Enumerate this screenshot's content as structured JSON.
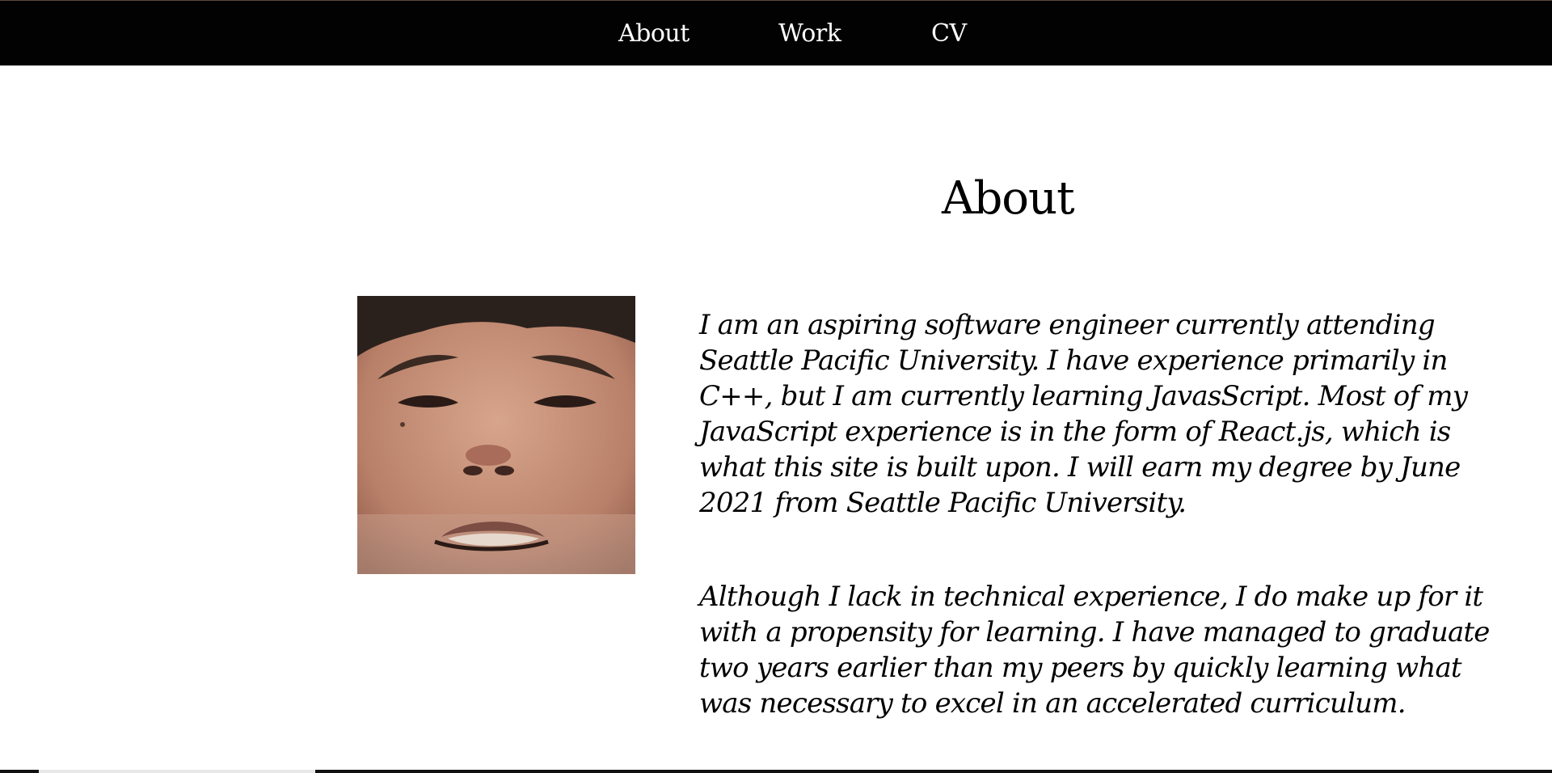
{
  "nav": {
    "items": [
      {
        "label": "About"
      },
      {
        "label": "Work"
      },
      {
        "label": "CV"
      }
    ]
  },
  "main": {
    "title": "About",
    "portrait_icon": "portrait-photo",
    "paragraphs": [
      "I am an aspiring software engineer currently attending Seattle Pacific University. I have experience primarily in C++, but I am currently learning JavasScript. Most of my JavaScript experience is in the form of React.js, which is what this site is built upon. I will earn my degree by June 2021 from Seattle Pacific University.",
      "Although I lack in technical experience, I do make up for it with a propensity for learning. I have managed to graduate two years earlier than my peers by quickly learning what was necessary to excel in an accelerated curriculum."
    ]
  },
  "colors": {
    "topbar_background": "#020202",
    "nav_text": "#ffffff",
    "page_background": "#ffffff",
    "body_text": "#000000"
  }
}
